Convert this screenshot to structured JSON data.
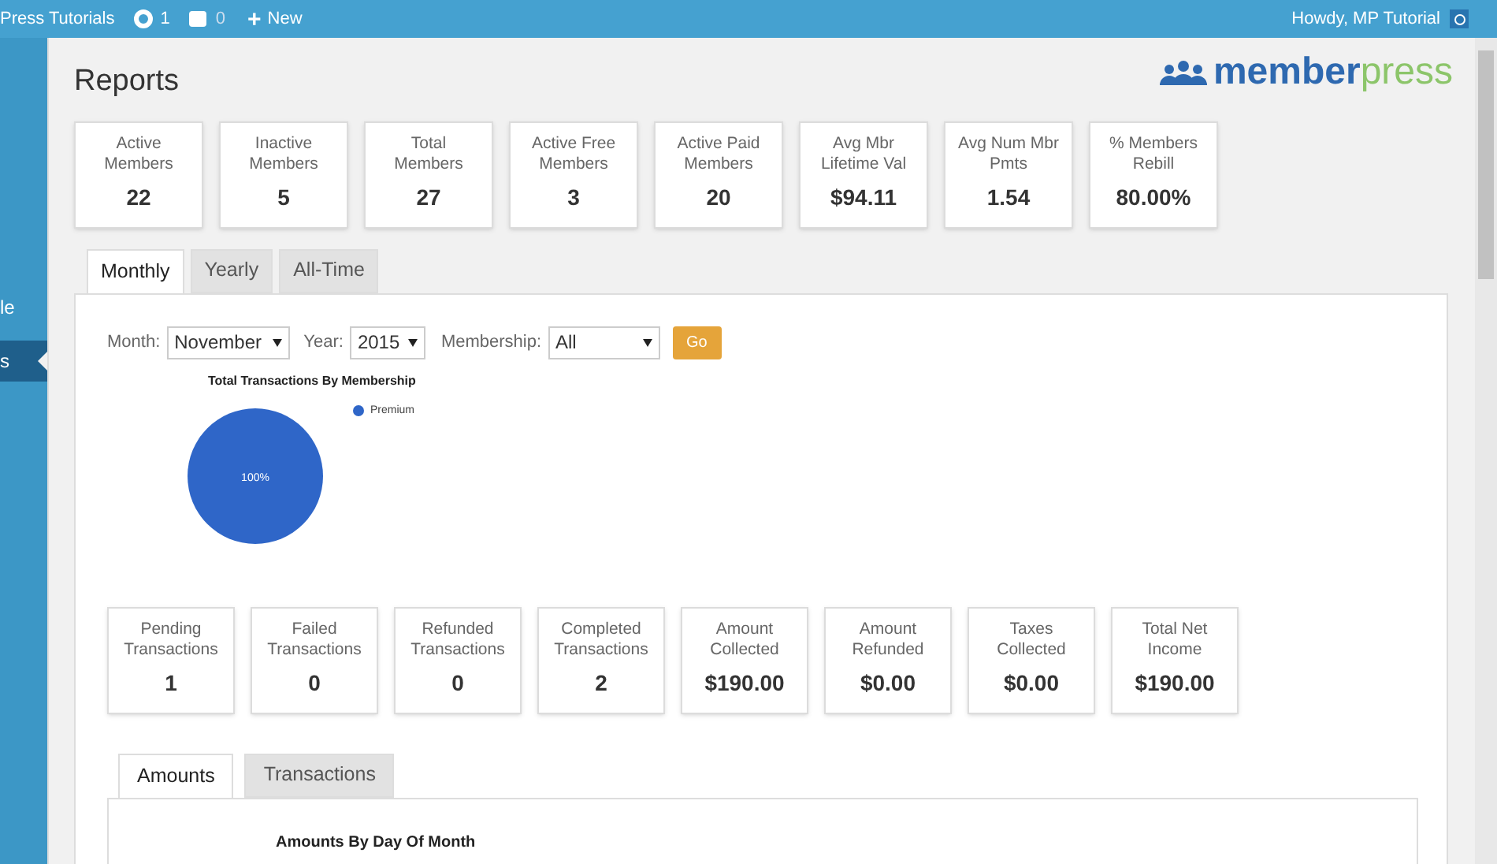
{
  "admin_bar": {
    "site": "Press Tutorials",
    "updates": "1",
    "comments": "0",
    "new_icon": "+",
    "new": "New",
    "howdy": "Howdy, MP Tutorial"
  },
  "sidebar": {
    "items": [
      {
        "label": "le",
        "selected": false
      },
      {
        "label": "s",
        "selected": true
      }
    ]
  },
  "page": {
    "title": "Reports",
    "logo": {
      "bold": "member",
      "light": "press"
    }
  },
  "member_stats": [
    {
      "label": "Active Members",
      "value": "22"
    },
    {
      "label": "Inactive Members",
      "value": "5"
    },
    {
      "label": "Total Members",
      "value": "27"
    },
    {
      "label": "Active Free Members",
      "value": "3"
    },
    {
      "label": "Active Paid Members",
      "value": "20"
    },
    {
      "label": "Avg Mbr Lifetime Val",
      "value": "$94.11"
    },
    {
      "label": "Avg Num Mbr Pmts",
      "value": "1.54"
    },
    {
      "label": "% Members Rebill",
      "value": "80.00%"
    }
  ],
  "tabs": [
    {
      "label": "Monthly",
      "selected": true
    },
    {
      "label": "Yearly",
      "selected": false
    },
    {
      "label": "All-Time",
      "selected": false
    }
  ],
  "filters": {
    "month_label": "Month:",
    "month": "November",
    "year_label": "Year:",
    "year": "2015",
    "membership_label": "Membership:",
    "membership": "All",
    "go": "Go"
  },
  "pie": {
    "chart_data": {
      "type": "pie",
      "title": "Total Transactions By Membership",
      "series": [
        {
          "name": "Premium",
          "color": "#2f66c8",
          "values": [
            100
          ]
        }
      ],
      "value_labels": [
        "100%"
      ]
    }
  },
  "transaction_stats": [
    {
      "label": "Pending Transactions",
      "value": "1"
    },
    {
      "label": "Failed Transactions",
      "value": "0"
    },
    {
      "label": "Refunded Transactions",
      "value": "0"
    },
    {
      "label": "Completed Transactions",
      "value": "2"
    },
    {
      "label": "Amount Collected",
      "value": "$190.00"
    },
    {
      "label": "Amount Refunded",
      "value": "$0.00"
    },
    {
      "label": "Taxes Collected",
      "value": "$0.00"
    },
    {
      "label": "Total Net Income",
      "value": "$190.00"
    }
  ],
  "sub_tabs": [
    {
      "label": "Amounts",
      "selected": true
    },
    {
      "label": "Transactions",
      "selected": false
    }
  ],
  "amounts_title": "Amounts By Day Of Month"
}
